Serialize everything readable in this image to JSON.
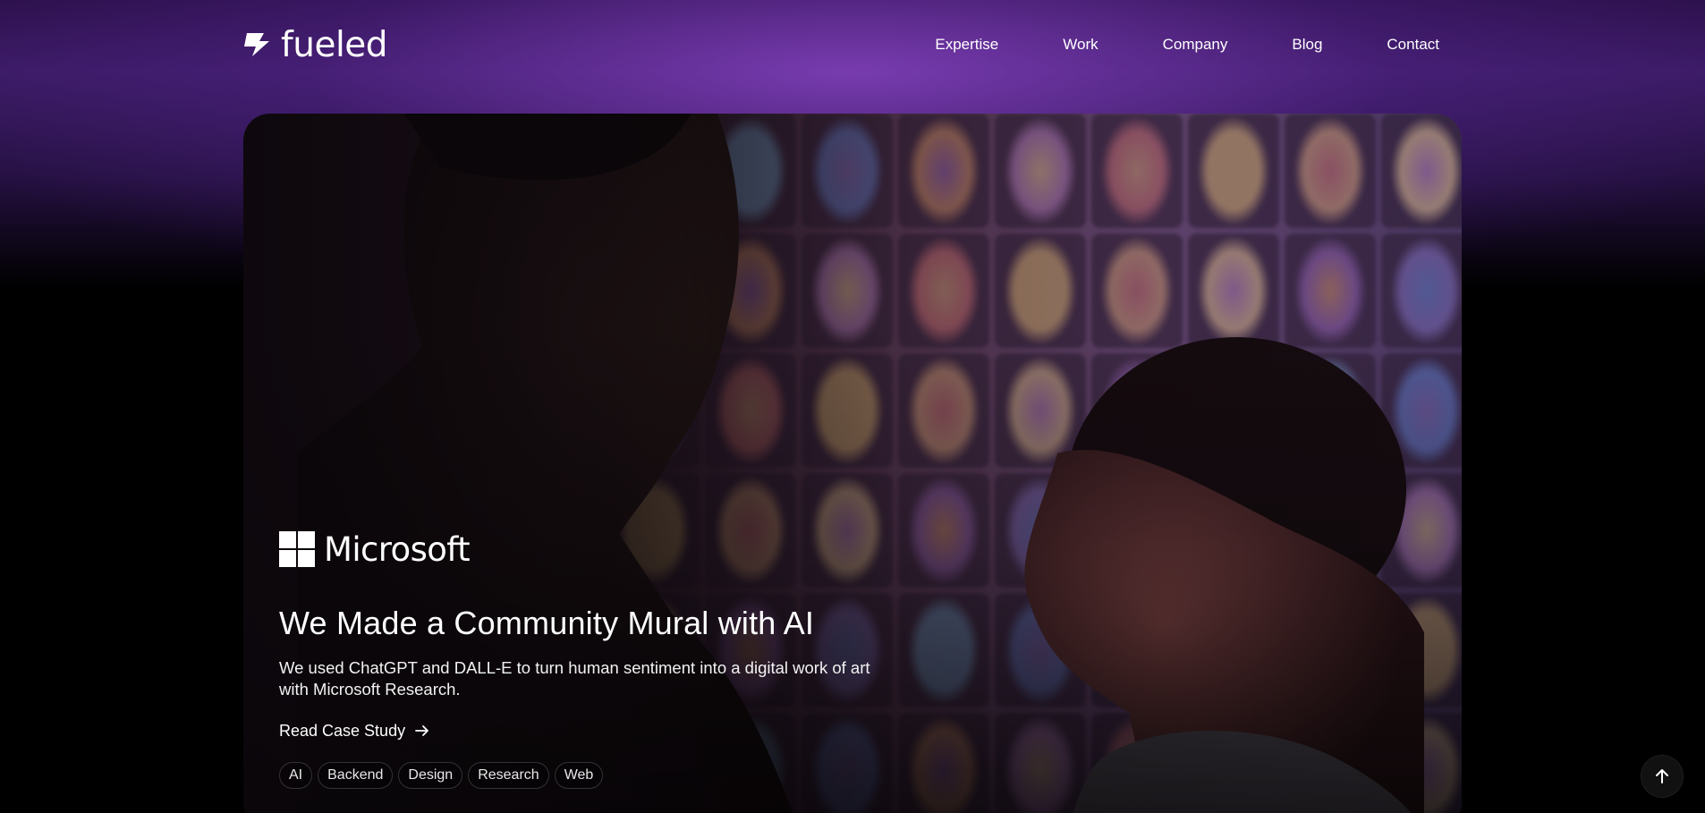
{
  "brand": {
    "name": "fueled",
    "icon": "bolt-icon"
  },
  "nav": {
    "items": [
      {
        "label": "Expertise"
      },
      {
        "label": "Work"
      },
      {
        "label": "Company"
      },
      {
        "label": "Blog"
      },
      {
        "label": "Contact"
      }
    ]
  },
  "hero": {
    "client_logo": {
      "name": "Microsoft",
      "icon": "microsoft-windows-icon"
    },
    "title": "We Made a Community Mural with AI",
    "description": "We used ChatGPT and DALL-E to turn human sentiment into a digital work of art with Microsoft Research.",
    "cta_label": "Read Case Study",
    "tags": [
      "AI",
      "Backend",
      "Design",
      "Research",
      "Web"
    ]
  },
  "scroll_top": {
    "icon": "arrow-up-icon"
  },
  "colors": {
    "background": "#000000",
    "header_glow": "#6a34a8",
    "text": "#ffffff"
  }
}
